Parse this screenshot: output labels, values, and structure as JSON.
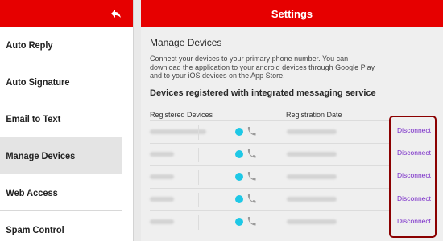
{
  "header": {
    "title": "Settings"
  },
  "sidebar": {
    "back_icon": "back-arrow-icon",
    "items": [
      {
        "label": "Auto Reply",
        "active": false
      },
      {
        "label": "Auto Signature",
        "active": false
      },
      {
        "label": "Email to Text",
        "active": false
      },
      {
        "label": "Manage Devices",
        "active": true
      },
      {
        "label": "Web Access",
        "active": false
      },
      {
        "label": "Spam Control",
        "active": false
      }
    ]
  },
  "main": {
    "section_title": "Manage Devices",
    "description": "Connect your devices to your primary phone number. You can download the application to your android devices through Google Play and to your iOS devices on the App Store.",
    "subtitle": "Devices registered with integrated messaging service",
    "columns": {
      "devices": "Registered Devices",
      "date": "Registration Date"
    },
    "rows": [
      {
        "action": "Disconnect"
      },
      {
        "action": "Disconnect"
      },
      {
        "action": "Disconnect"
      },
      {
        "action": "Disconnect"
      },
      {
        "action": "Disconnect"
      }
    ]
  },
  "colors": {
    "brand_red": "#e60000",
    "link_purple": "#7b2fc9",
    "chat_cyan": "#1ec8e6",
    "highlight_border": "#8b0000"
  }
}
